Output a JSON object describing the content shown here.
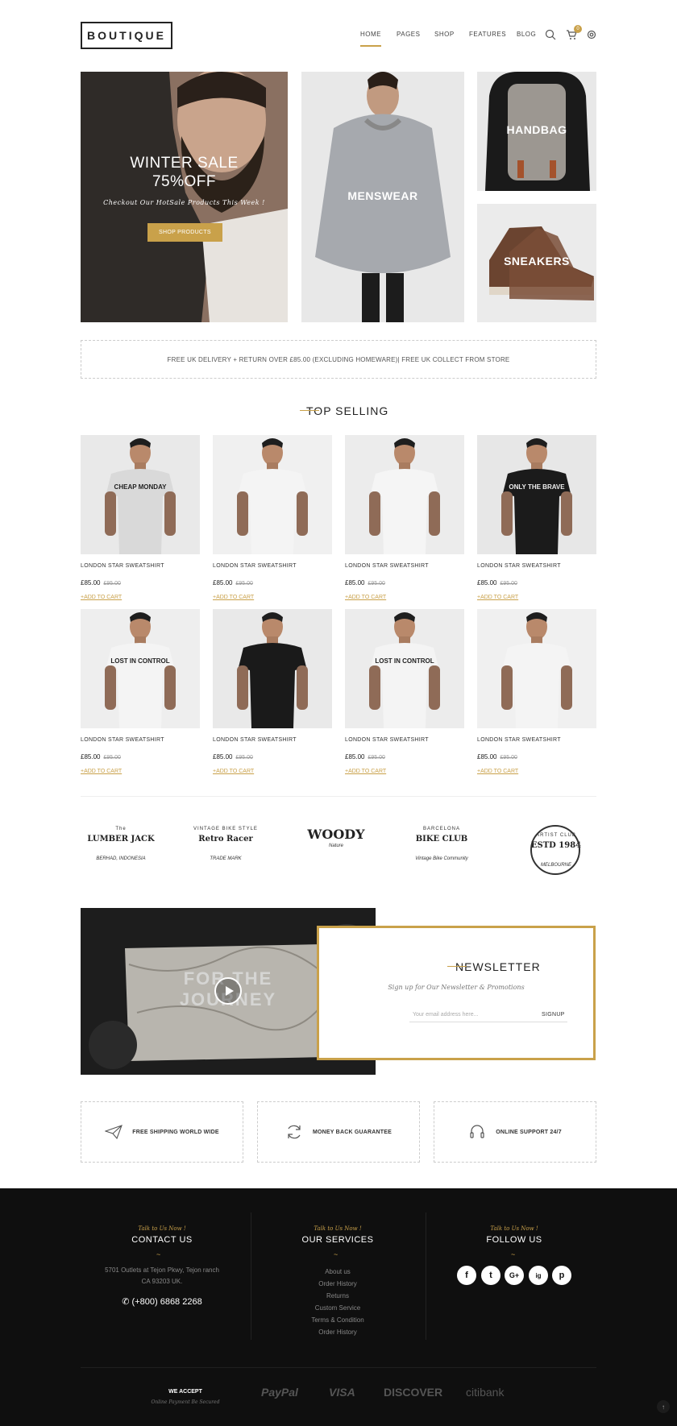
{
  "header": {
    "logo": "BOUTIQUE",
    "nav": [
      "HOME",
      "PAGES",
      "SHOP",
      "FEATURES",
      "BLOG"
    ],
    "cart_count": "0",
    "icons": [
      "search-icon",
      "cart-icon",
      "gear-icon"
    ]
  },
  "hero": {
    "title_line1": "WINTER SALE",
    "title_line2": "75%OFF",
    "subtitle": "Checkout Our HotSale Products This Week !",
    "cta": "SHOP PRODUCTS"
  },
  "categories": {
    "menswear": "MENSWEAR",
    "handbag": "HANDBAG",
    "sneakers": "SNEAKERS"
  },
  "delivery": {
    "text": "FREE UK DELIVERY + RETURN OVER £85.00 (EXCLUDING HOMEWARE)| FREE UK COLLECT FROM STORE"
  },
  "top_selling": {
    "title": "TOP SELLING",
    "products": [
      {
        "name": "LONDON STAR SWEATSHIRT",
        "price": "£85.00",
        "old_price": "£95.00",
        "add": "+ADD TO CART",
        "shirt_text": "CHEAP MONDAY"
      },
      {
        "name": "LONDON STAR SWEATSHIRT",
        "price": "£85.00",
        "old_price": "£95.00",
        "add": "+ADD TO CART",
        "shirt_text": ""
      },
      {
        "name": "LONDON STAR SWEATSHIRT",
        "price": "£85.00",
        "old_price": "£95.00",
        "add": "+ADD TO CART",
        "shirt_text": ""
      },
      {
        "name": "LONDON STAR SWEATSHIRT",
        "price": "£85.00",
        "old_price": "£95.00",
        "add": "+ADD TO CART",
        "shirt_text": "ONLY THE BRAVE"
      },
      {
        "name": "LONDON STAR SWEATSHIRT",
        "price": "£85.00",
        "old_price": "£95.00",
        "add": "+ADD TO CART",
        "shirt_text": "LOST IN CONTROL"
      },
      {
        "name": "LONDON STAR SWEATSHIRT",
        "price": "£85.00",
        "old_price": "£95.00",
        "add": "+ADD TO CART",
        "shirt_text": ""
      },
      {
        "name": "LONDON STAR SWEATSHIRT",
        "price": "£85.00",
        "old_price": "£95.00",
        "add": "+ADD TO CART",
        "shirt_text": "LOST IN CONTROL"
      },
      {
        "name": "LONDON STAR SWEATSHIRT",
        "price": "£85.00",
        "old_price": "£95.00",
        "add": "+ADD TO CART",
        "shirt_text": ""
      }
    ]
  },
  "brands": [
    {
      "top": "The",
      "main": "LUMBER JACK",
      "sub": "BERHAD, INDONESIA"
    },
    {
      "top": "VINTAGE BIKE STYLE",
      "main": "Retro Racer",
      "sub": "TRADE MARK"
    },
    {
      "top": "",
      "main": "WOODY",
      "sub": "Nature"
    },
    {
      "top": "BARCELONA",
      "main": "BIKE CLUB",
      "sub": "Vintage Bike Community"
    },
    {
      "top": "ARTIST CLUB",
      "main": "ESTD 1984",
      "sub": "MELBOURNE"
    }
  ],
  "video": {
    "overlay_text": "FOR THE JOURNEY"
  },
  "newsletter": {
    "title": "NEWSLETTER",
    "subtitle": "Sign up for Our Newsletter & Promotions",
    "placeholder": "Your email address here...",
    "button": "SIGNUP"
  },
  "features": [
    {
      "label": "FREE SHIPPING WORLD WIDE",
      "icon": "paper-plane-icon"
    },
    {
      "label": "MONEY BACK GUARANTEE",
      "icon": "refresh-icon"
    },
    {
      "label": "ONLINE SUPPORT 24/7",
      "icon": "headset-icon"
    }
  ],
  "footer": {
    "contact": {
      "script": "Talk to Us Now !",
      "title": "CONTACT US",
      "address_line1": "5701 Outlets at Tejon Pkwy, Tejon ranch",
      "address_line2": "CA 93203 UK.",
      "phone": "(+800) 6868 2268"
    },
    "services": {
      "script": "Talk to Us Now !",
      "title": "OUR SERVICES",
      "links": [
        "About us",
        "Order History",
        "Returns",
        "Custom Service",
        "Terms & Condition",
        "Order History"
      ]
    },
    "follow": {
      "script": "Talk to Us Now !",
      "title": "FOLLOW US",
      "socials": [
        "f",
        "t",
        "G+",
        "ig",
        "p"
      ]
    },
    "accept": {
      "title": "WE ACCEPT",
      "subtitle": "Online Payment Be Secured"
    },
    "payments": [
      "PayPal",
      "VISA",
      "DISCOVER",
      "citibank"
    ]
  },
  "colors": {
    "accent": "#c9a14a",
    "footer_bg": "#0f0f0f"
  }
}
